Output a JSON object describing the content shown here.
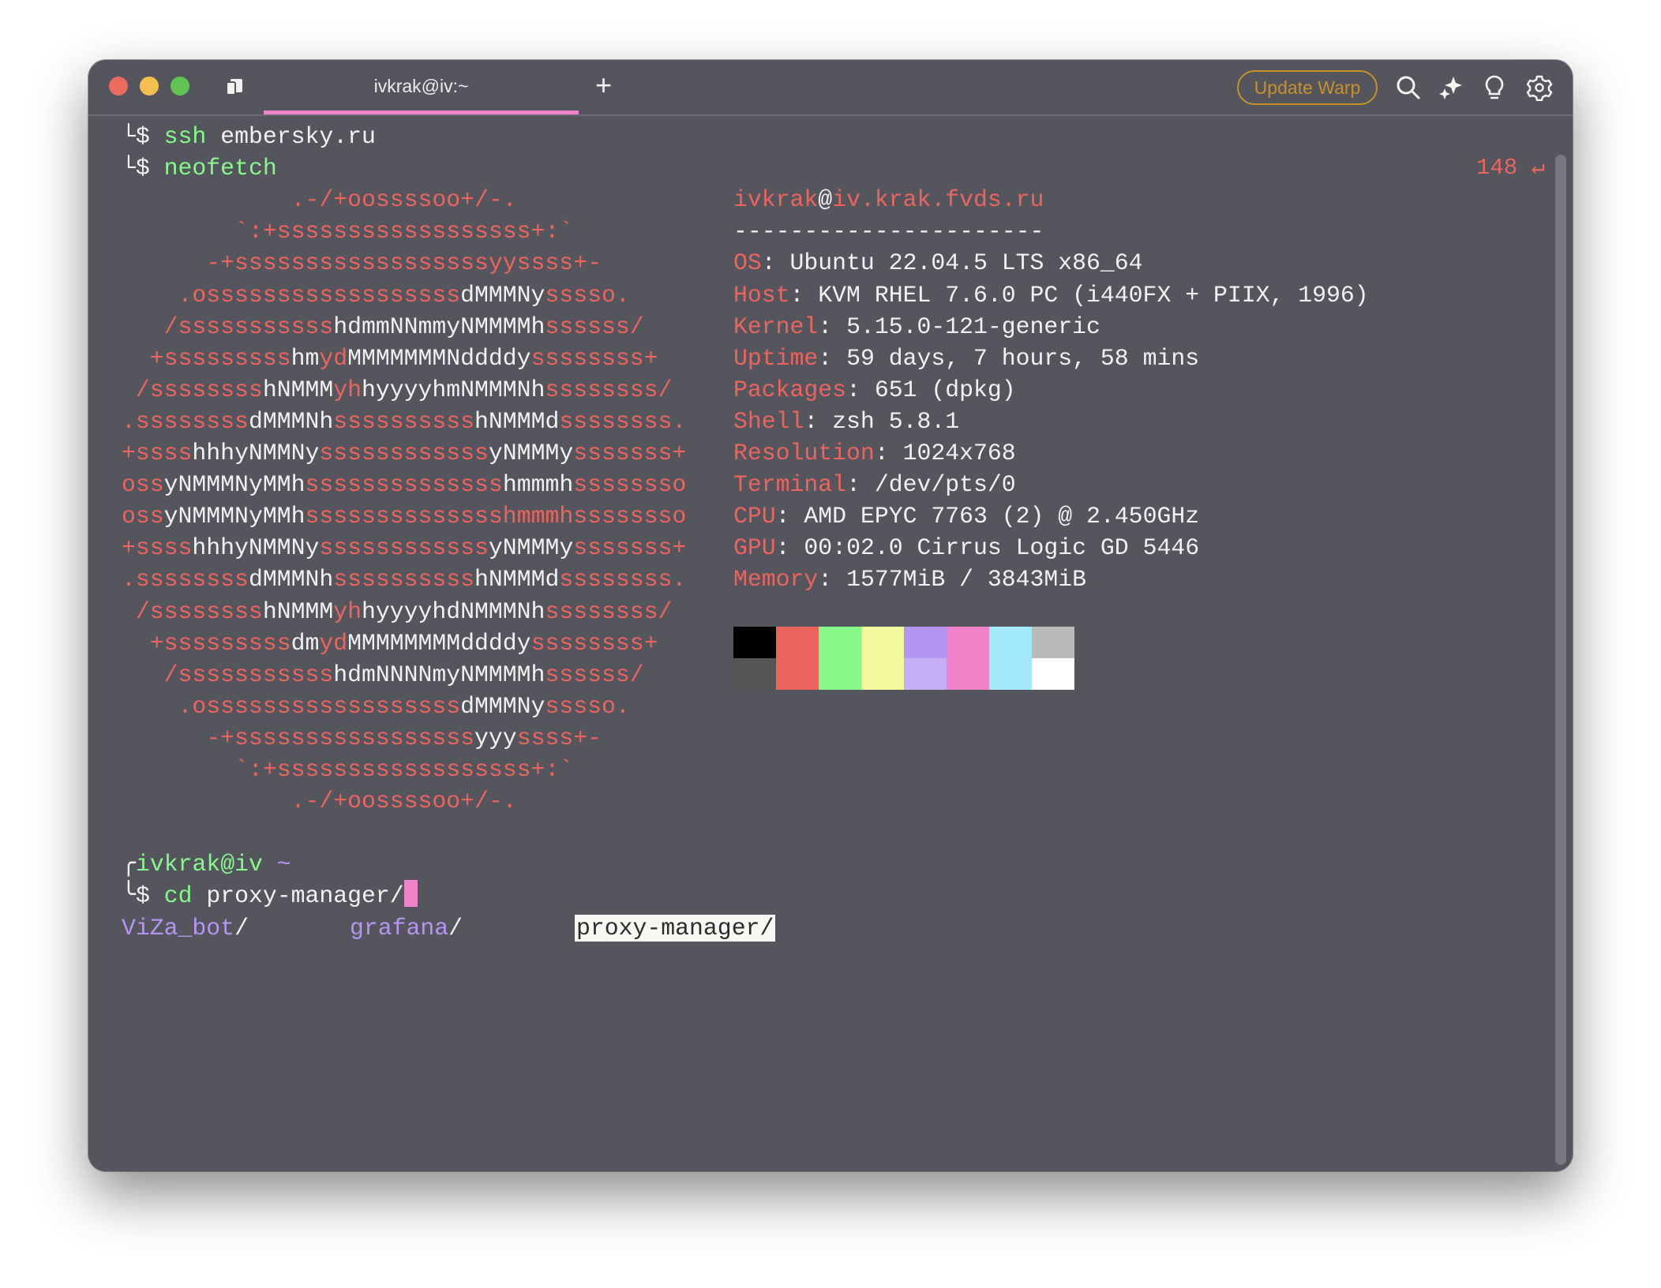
{
  "titlebar": {
    "tab_title": "ivkrak@iv:~",
    "new_tab": "+",
    "update_button": "Update Warp",
    "icons": [
      "search-icon",
      "ai-sparkle-icon",
      "lightbulb-icon",
      "gear-icon"
    ],
    "traffic_lights": {
      "close": "#ed6a5e",
      "minimize": "#f5bf4f",
      "maximize": "#61c554"
    },
    "tab_accent": "#ef82c8"
  },
  "terminal": {
    "history": [
      {
        "prefix": "└$ ",
        "cmd": "ssh",
        "args": " embersky.ru"
      },
      {
        "prefix": "└$ ",
        "cmd": "neofetch",
        "args": ""
      }
    ],
    "exit_code": "148",
    "exit_icon": "↵",
    "logo": [
      [
        [
          "r",
          "            .-/+oossssoo+/-."
        ]
      ],
      [
        [
          "r",
          "        `:+ssssssssssssssssss+:`"
        ]
      ],
      [
        [
          "r",
          "      -+ssssssssssssssssssyyssss+-"
        ]
      ],
      [
        [
          "r",
          "    .ossssssssssssssssss"
        ],
        [
          "w",
          "dMMMNy"
        ],
        [
          "r",
          "sssso."
        ]
      ],
      [
        [
          "r",
          "   /sssssssssss"
        ],
        [
          "w",
          "hdmmNNmmyNMMMMh"
        ],
        [
          "r",
          "ssssss/"
        ]
      ],
      [
        [
          "r",
          "  +sssssssss"
        ],
        [
          "w",
          "hm"
        ],
        [
          "r",
          "yd"
        ],
        [
          "w",
          "MMMMMMMNddddy"
        ],
        [
          "r",
          "ssssssss+"
        ]
      ],
      [
        [
          "r",
          " /ssssssss"
        ],
        [
          "w",
          "hNMMM"
        ],
        [
          "r",
          "yh"
        ],
        [
          "w",
          "hyyyyhmNMMMNh"
        ],
        [
          "r",
          "ssssssss/"
        ]
      ],
      [
        [
          "r",
          ".ssssssss"
        ],
        [
          "w",
          "dMMMNh"
        ],
        [
          "r",
          "ssssssssss"
        ],
        [
          "w",
          "hNMMMd"
        ],
        [
          "r",
          "ssssssss."
        ]
      ],
      [
        [
          "r",
          "+ssss"
        ],
        [
          "w",
          "hhhyNMMNy"
        ],
        [
          "r",
          "ssssssssssss"
        ],
        [
          "w",
          "yNMMMy"
        ],
        [
          "r",
          "sssssss+"
        ]
      ],
      [
        [
          "r",
          "oss"
        ],
        [
          "w",
          "yNMMMNyMMh"
        ],
        [
          "r",
          "ssssssssssssss"
        ],
        [
          "w",
          "hmmmh"
        ],
        [
          "r",
          "ssssssso"
        ]
      ],
      [
        [
          "r",
          "oss"
        ],
        [
          "w",
          "yNMMMNyMMh"
        ],
        [
          "r",
          "sssssssssssssshmmmhssssssso"
        ]
      ],
      [
        [
          "r",
          "+ssss"
        ],
        [
          "w",
          "hhhyNMMNy"
        ],
        [
          "r",
          "ssssssssssss"
        ],
        [
          "w",
          "yNMMMy"
        ],
        [
          "r",
          "sssssss+"
        ]
      ],
      [
        [
          "r",
          ".ssssssss"
        ],
        [
          "w",
          "dMMMNh"
        ],
        [
          "r",
          "ssssssssss"
        ],
        [
          "w",
          "hNMMMd"
        ],
        [
          "r",
          "ssssssss."
        ]
      ],
      [
        [
          "r",
          " /ssssssss"
        ],
        [
          "w",
          "hNMMM"
        ],
        [
          "r",
          "yh"
        ],
        [
          "w",
          "hyyyyhdNMMMNh"
        ],
        [
          "r",
          "ssssssss/"
        ]
      ],
      [
        [
          "r",
          "  +sssssssss"
        ],
        [
          "w",
          "dm"
        ],
        [
          "r",
          "yd"
        ],
        [
          "w",
          "MMMMMMMMddddy"
        ],
        [
          "r",
          "ssssssss+"
        ]
      ],
      [
        [
          "r",
          "   /sssssssssss"
        ],
        [
          "w",
          "hdmNNNNmyNMMMMh"
        ],
        [
          "r",
          "ssssss/"
        ]
      ],
      [
        [
          "r",
          "    .ossssssssssssssssss"
        ],
        [
          "w",
          "dMMMNy"
        ],
        [
          "r",
          "sssso."
        ]
      ],
      [
        [
          "r",
          "      -+sssssssssssssssss"
        ],
        [
          "w",
          "yyy"
        ],
        [
          "r",
          "ssss+-"
        ]
      ],
      [
        [
          "r",
          "        `:+ssssssssssssssssss+:`"
        ]
      ],
      [
        [
          "r",
          "            .-/+oossssoo+/-."
        ]
      ]
    ],
    "info_header": {
      "user": "ivkrak",
      "at": "@",
      "host": "iv.krak.fvds.ru",
      "separator": "----------------------"
    },
    "info": [
      {
        "key": "OS",
        "value": "Ubuntu 22.04.5 LTS x86_64"
      },
      {
        "key": "Host",
        "value": "KVM RHEL 7.6.0 PC (i440FX + PIIX, 1996)"
      },
      {
        "key": "Kernel",
        "value": "5.15.0-121-generic"
      },
      {
        "key": "Uptime",
        "value": "59 days, 7 hours, 58 mins"
      },
      {
        "key": "Packages",
        "value": "651 (dpkg)"
      },
      {
        "key": "Shell",
        "value": "zsh 5.8.1"
      },
      {
        "key": "Resolution",
        "value": "1024x768"
      },
      {
        "key": "Terminal",
        "value": "/dev/pts/0"
      },
      {
        "key": "CPU",
        "value": "AMD EPYC 7763 (2) @ 2.450GHz"
      },
      {
        "key": "GPU",
        "value": "00:02.0 Cirrus Logic GD 5446"
      },
      {
        "key": "Memory",
        "value": "1577MiB / 3843MiB"
      }
    ],
    "palette": {
      "normal": [
        "#000000",
        "#ec645e",
        "#86f98a",
        "#f3f99d",
        "#b595f2",
        "#ef82c8",
        "#a3e8f8",
        "#bababa"
      ],
      "bright": [
        "#555555",
        "#ec645e",
        "#86f98a",
        "#f3f99d",
        "#c4aef5",
        "#ef82c8",
        "#a3e8f8",
        "#ffffff"
      ]
    },
    "prompt": {
      "top": "╭",
      "user_host": "ivkrak@iv",
      "path": "~",
      "bottom": "╰$ ",
      "cmd": "cd",
      "input": " proxy-manager/"
    },
    "completions": [
      {
        "name": "ViZa_bot",
        "suffix": "/",
        "selected": false
      },
      {
        "name": "grafana",
        "suffix": "/",
        "selected": false
      },
      {
        "name": "proxy-manager/",
        "suffix": "",
        "selected": true
      }
    ]
  }
}
